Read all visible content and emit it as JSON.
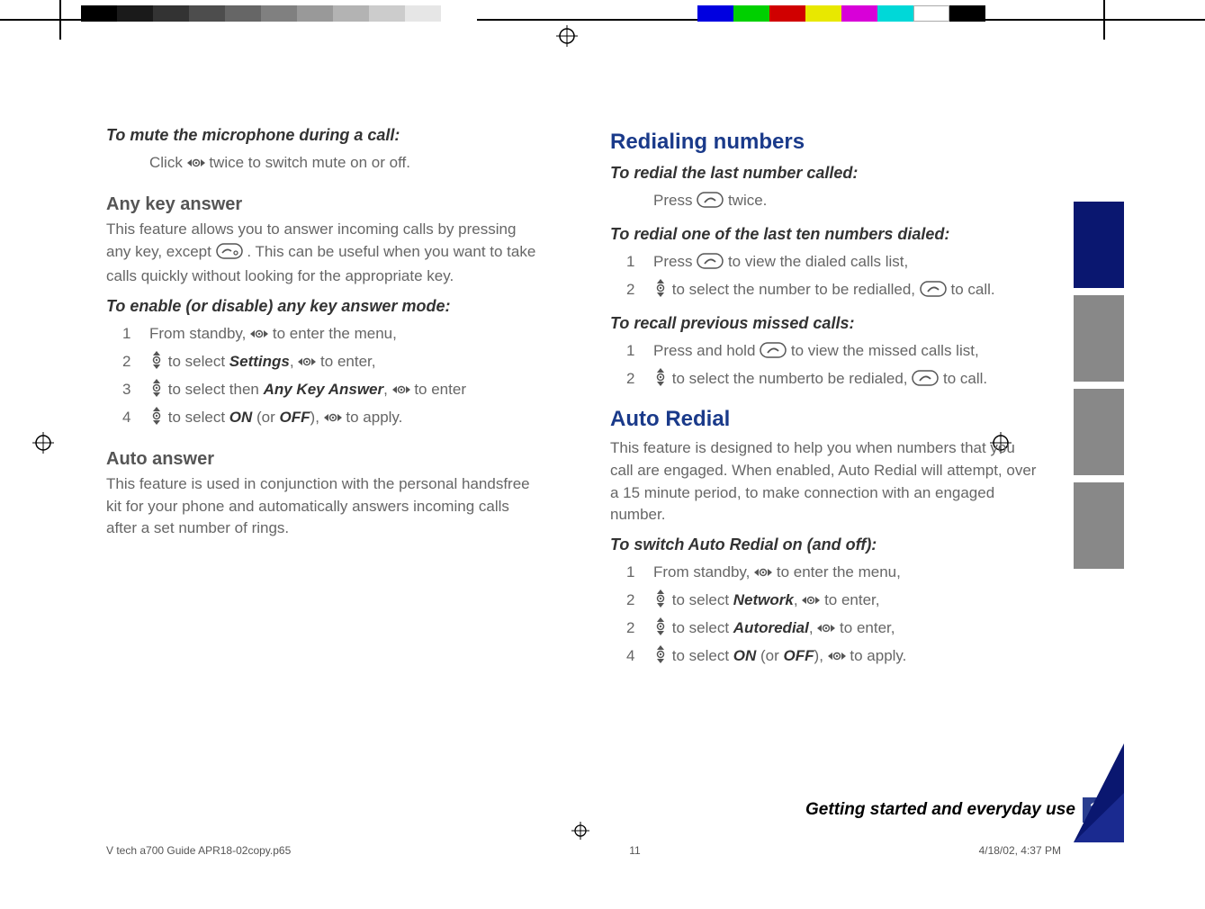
{
  "top_grey_shades": [
    "#000000",
    "#1a1a1a",
    "#333333",
    "#4d4d4d",
    "#666666",
    "#808080",
    "#999999",
    "#b3b3b3",
    "#cccccc",
    "#e6e6e6",
    "#ffffff"
  ],
  "top_color_bars": [
    "#0000e0",
    "#00d000",
    "#d00000",
    "#e8e800",
    "#d800d8",
    "#00d8d8",
    "#ffffff",
    "#000000"
  ],
  "side_strip": [
    "#0a1770",
    "#888888",
    "#888888",
    "#888888"
  ],
  "left": {
    "mute_h": "To mute the microphone during a call:",
    "mute_step": "twice to switch mute on or off.",
    "mute_click": "Click",
    "anykey_h": "Any key answer",
    "anykey_body_a": "This feature allows you to answer incoming calls by pressing any key, except",
    "anykey_body_b": ". This can be useful when you want to take calls quickly without looking for the appropriate key.",
    "anykey_enable_h": "To enable (or disable) any key answer mode:",
    "s1_a": "From standby,",
    "s1_b": "to enter the menu,",
    "s2_a": "to select",
    "s2_set": "Settings",
    "s2_b": ",",
    "s2_c": "to enter,",
    "s3_a": "to select then",
    "s3_ak": "Any Key Answer",
    "s3_b": ",",
    "s3_c": "to enter",
    "s4_a": "to select",
    "s4_on": "ON",
    "s4_or": "(or",
    "s4_off": "OFF",
    "s4_b": "),",
    "s4_c": "to apply.",
    "auto_h": "Auto answer",
    "auto_body": "This feature is used in conjunction with the personal handsfree kit for your phone and automatically answers incoming calls after a set number of rings."
  },
  "right": {
    "redial_h": "Redialing numbers",
    "last_h": "To redial the last number called:",
    "last_press": "Press",
    "last_twice": "twice.",
    "ten_h": "To redial one of the last ten numbers dialed:",
    "ten1_a": "Press",
    "ten1_b": "to view the dialed calls list,",
    "ten2_a": "to select the number to be redialled,",
    "ten2_b": "to call.",
    "missed_h": "To recall previous missed calls:",
    "missed1_a": "Press and hold",
    "missed1_b": "to view the missed calls list,",
    "missed2_a": "to select the numberto be redialed,",
    "missed2_b": "to call.",
    "ar_h": "Auto Redial",
    "ar_body": "This feature is designed to help you when numbers that you call are engaged. When enabled, Auto Redial will attempt, over a 15 minute period, to make connection with an engaged number.",
    "ar_switch_h": "To switch Auto Redial on (and off):",
    "ar1_a": "From standby,",
    "ar1_b": "to enter the menu,",
    "ar2_a": "to select",
    "ar2_net": "Network",
    "ar2_b": ",",
    "ar2_c": "to enter,",
    "ar3_a": "to select",
    "ar3_au": "Autoredial",
    "ar3_b": ",",
    "ar3_c": "to enter,",
    "ar4_a": "to select",
    "ar4_on": "ON",
    "ar4_or": "(or",
    "ar4_off": "OFF",
    "ar4_b": "),",
    "ar4_c": "to apply."
  },
  "footer": {
    "section": "Getting started and everyday use",
    "page": "11"
  },
  "meta": {
    "file": "V tech a700 Guide APR18-02copy.p65",
    "pg": "11",
    "date": "4/18/02, 4:37 PM"
  }
}
